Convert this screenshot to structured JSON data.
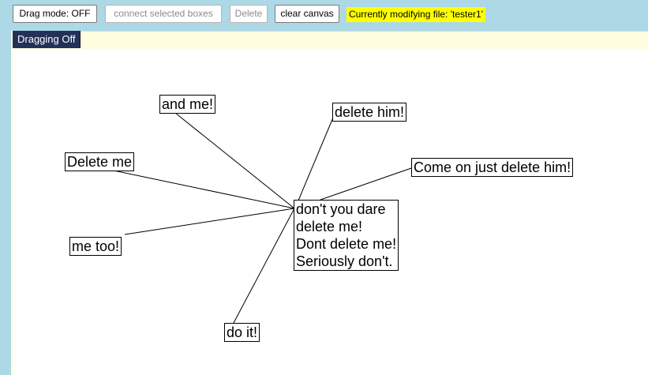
{
  "toolbar": {
    "drag_mode": "Drag mode: OFF",
    "connect": "connect selected boxes",
    "delete": "Delete",
    "clear": "clear canvas",
    "status": "Currently modifying file: 'tester1'"
  },
  "canvas": {
    "mode_tab": "Dragging Off",
    "boxes": {
      "and_me": "and me!",
      "delete_him": "delete him!",
      "delete_me": "Delete me",
      "come_on": "Come on just delete him!",
      "center": "don't you dare\ndelete me!\nDont delete me!\nSeriously don't.",
      "me_too": "me too!",
      "do_it": "do it!"
    }
  },
  "colors": {
    "page_bg": "#add8e6",
    "status_bg": "#ffff00",
    "tab_bg": "#233159",
    "strip_bg": "#fffde0"
  }
}
